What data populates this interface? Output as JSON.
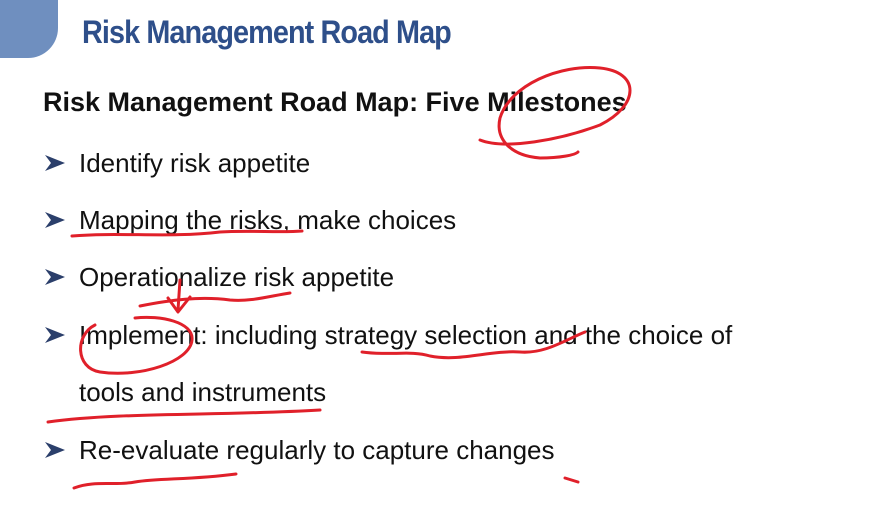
{
  "slide": {
    "title": "Risk Management Road Map",
    "heading": "Risk Management Road Map: Five Milestones",
    "bullets": [
      "Identify risk appetite",
      "Mapping the risks, make choices",
      "Operationalize risk appetite",
      "Implement: including strategy selection and the choice of",
      "Re-evaluate regularly to capture changes"
    ],
    "bullet_4_continuation": "tools and instruments"
  },
  "colors": {
    "title_blue": "#2e4f8a",
    "corner_tab": "#6f8fbf",
    "text": "#111111",
    "ink_red": "#e0202a",
    "arrow_fill": "#2b3f6b"
  }
}
